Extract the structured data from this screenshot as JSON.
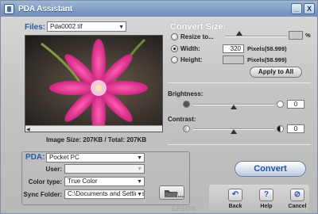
{
  "window": {
    "title": "PDA Assistant",
    "min_label": "_",
    "close_label": "X"
  },
  "files": {
    "label": "Files:",
    "selected": "Pda0002.tif"
  },
  "preview": {
    "image_size_text": "Image Size: 207KB / Total: 207KB"
  },
  "convert_size": {
    "label": "Convert Size:",
    "resize": {
      "label": "Resize to...",
      "unit": "%",
      "selected": false
    },
    "width": {
      "label": "Width:",
      "value": "320",
      "unit_text": "Pixels(58.999)",
      "selected": true
    },
    "height": {
      "label": "Height:",
      "value": "",
      "unit_text": "Pixels(58.999)",
      "selected": false
    },
    "apply_label": "Apply to All"
  },
  "brightness": {
    "label": "Brightness:",
    "value": "0",
    "level_fraction": 0.5
  },
  "contrast": {
    "label": "Contrast:",
    "value": "0",
    "level_fraction": 0.5
  },
  "pda": {
    "label": "PDA:",
    "device": "Pocket PC",
    "user_label": "User:",
    "user_value": "",
    "color_type_label": "Color type:",
    "color_type_value": "True Color",
    "sync_folder_label": "Sync Folder:",
    "sync_folder_value": "C:\\Documents and Settings"
  },
  "actions": {
    "convert_label": "Convert",
    "back_label": "Back",
    "help_label": "Help",
    "cancel_label": "Cancel"
  },
  "brand": "EPSON",
  "colors": {
    "accent_blue": "#2a5aa8",
    "titlebar": "#7f9dc4"
  },
  "icons": [
    "app-icon",
    "minimize-icon",
    "close-icon",
    "folder-icon",
    "back-icon",
    "help-icon",
    "cancel-icon",
    "brightness-icon",
    "contrast-icon"
  ]
}
